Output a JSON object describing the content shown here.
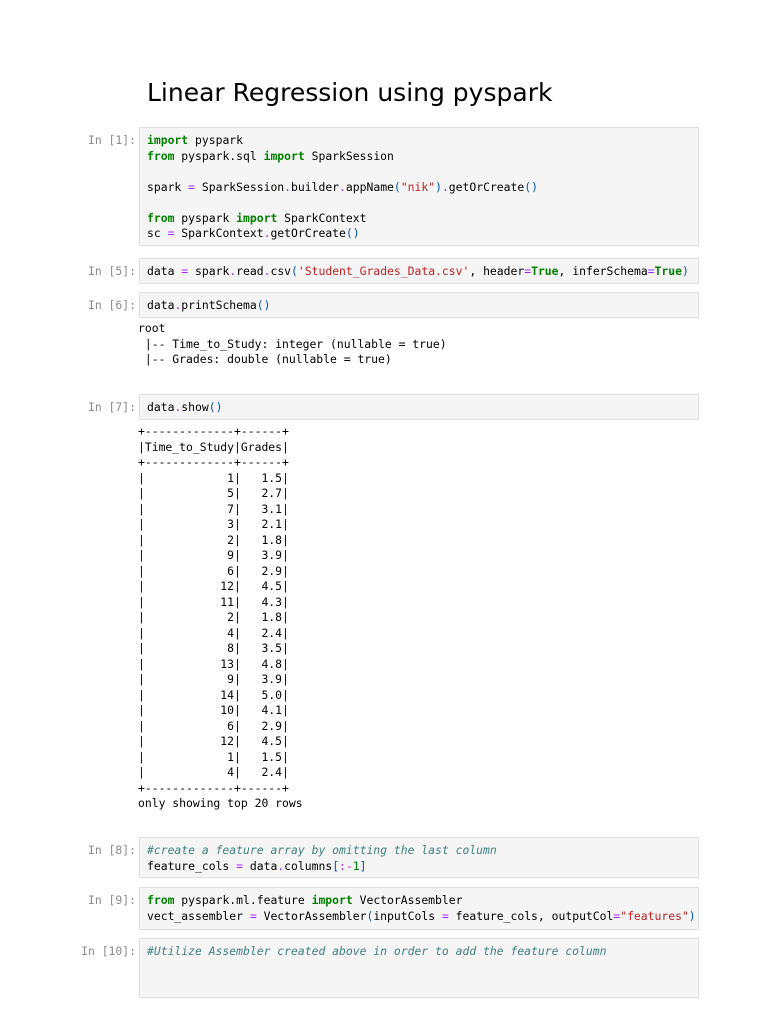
{
  "title": "Linear Regression using pyspark",
  "cells": [
    {
      "prompt": "In [1]:",
      "lines": [
        [
          [
            "kw",
            "import"
          ],
          [
            "t",
            " pyspark"
          ]
        ],
        [
          [
            "kw",
            "from"
          ],
          [
            "t",
            " pyspark.sql "
          ],
          [
            "kw",
            "import"
          ],
          [
            "t",
            " SparkSession"
          ]
        ],
        [],
        [
          [
            "t",
            "spark "
          ],
          [
            "op",
            "="
          ],
          [
            "t",
            " SparkSession"
          ],
          [
            "op",
            "."
          ],
          [
            "t",
            "builder"
          ],
          [
            "op",
            "."
          ],
          [
            "t",
            "appName"
          ],
          [
            "br",
            "("
          ],
          [
            "str",
            "\"nik\""
          ],
          [
            "br",
            ")"
          ],
          [
            "op",
            "."
          ],
          [
            "t",
            "getOrCreate"
          ],
          [
            "br",
            "()"
          ]
        ],
        [],
        [
          [
            "kw",
            "from"
          ],
          [
            "t",
            " pyspark "
          ],
          [
            "kw",
            "import"
          ],
          [
            "t",
            " SparkContext"
          ]
        ],
        [
          [
            "t",
            "sc "
          ],
          [
            "op",
            "="
          ],
          [
            "t",
            " SparkContext"
          ],
          [
            "op",
            "."
          ],
          [
            "t",
            "getOrCreate"
          ],
          [
            "br",
            "()"
          ]
        ]
      ]
    },
    {
      "prompt": "In [5]:",
      "lines": [
        [
          [
            "t",
            "data "
          ],
          [
            "op",
            "="
          ],
          [
            "t",
            " spark"
          ],
          [
            "op",
            "."
          ],
          [
            "t",
            "read"
          ],
          [
            "op",
            "."
          ],
          [
            "t",
            "csv"
          ],
          [
            "br",
            "("
          ],
          [
            "str",
            "'Student_Grades_Data.csv'"
          ],
          [
            "t",
            ", header"
          ],
          [
            "op",
            "="
          ],
          [
            "kw",
            "True"
          ],
          [
            "t",
            ", inferSchema"
          ],
          [
            "op",
            "="
          ],
          [
            "kw",
            "True"
          ],
          [
            "br",
            ")"
          ]
        ]
      ]
    },
    {
      "prompt": "In [6]:",
      "lines": [
        [
          [
            "t",
            "data"
          ],
          [
            "op",
            "."
          ],
          [
            "t",
            "printSchema"
          ],
          [
            "br",
            "()"
          ]
        ]
      ],
      "output": [
        "root",
        " |-- Time_to_Study: integer (nullable = true)",
        " |-- Grades: double (nullable = true)"
      ]
    },
    {
      "prompt": "In [7]:",
      "lines": [
        [
          [
            "t",
            "data"
          ],
          [
            "op",
            "."
          ],
          [
            "t",
            "show"
          ],
          [
            "br",
            "()"
          ]
        ]
      ],
      "output": [
        "+-------------+------+",
        "|Time_to_Study|Grades|",
        "+-------------+------+",
        "|            1|   1.5|",
        "|            5|   2.7|",
        "|            7|   3.1|",
        "|            3|   2.1|",
        "|            2|   1.8|",
        "|            9|   3.9|",
        "|            6|   2.9|",
        "|           12|   4.5|",
        "|           11|   4.3|",
        "|            2|   1.8|",
        "|            4|   2.4|",
        "|            8|   3.5|",
        "|           13|   4.8|",
        "|            9|   3.9|",
        "|           14|   5.0|",
        "|           10|   4.1|",
        "|            6|   2.9|",
        "|           12|   4.5|",
        "|            1|   1.5|",
        "|            4|   2.4|",
        "+-------------+------+",
        "only showing top 20 rows"
      ]
    },
    {
      "prompt": "In [8]:",
      "lines": [
        [
          [
            "cm",
            "#create a feature array by omitting the last column"
          ]
        ],
        [
          [
            "t",
            "feature_cols "
          ],
          [
            "op",
            "="
          ],
          [
            "t",
            " data"
          ],
          [
            "op",
            "."
          ],
          [
            "t",
            "columns"
          ],
          [
            "br",
            "["
          ],
          [
            "op",
            ":-"
          ],
          [
            "num",
            "1"
          ],
          [
            "br",
            "]"
          ]
        ]
      ]
    },
    {
      "prompt": "In [9]:",
      "lines": [
        [
          [
            "kw",
            "from"
          ],
          [
            "t",
            " pyspark.ml.feature "
          ],
          [
            "kw",
            "import"
          ],
          [
            "t",
            " VectorAssembler"
          ]
        ],
        [
          [
            "t",
            "vect_assembler "
          ],
          [
            "op",
            "="
          ],
          [
            "t",
            " VectorAssembler"
          ],
          [
            "br",
            "("
          ],
          [
            "t",
            "inputCols "
          ],
          [
            "op",
            "="
          ],
          [
            "t",
            " feature_cols, outputCol"
          ],
          [
            "op",
            "="
          ],
          [
            "str",
            "\"features\""
          ],
          [
            "br",
            ")"
          ]
        ]
      ]
    },
    {
      "prompt": "In [10]:",
      "lines": [
        [
          [
            "cm",
            "#Utilize Assembler created above in order to add the feature column"
          ]
        ],
        [],
        []
      ]
    }
  ]
}
